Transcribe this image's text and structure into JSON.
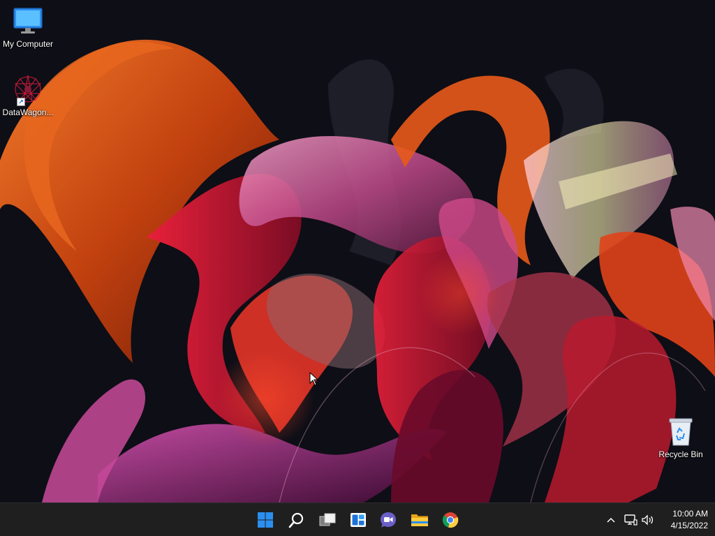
{
  "desktop": {
    "icons": [
      {
        "label": "My Computer",
        "icon": "monitor-icon"
      },
      {
        "label": "DataWagon...",
        "icon": "datawagon-logo-icon",
        "shortcut": true
      },
      {
        "label": "Recycle Bin",
        "icon": "recycle-bin-icon"
      }
    ]
  },
  "taskbar": {
    "pinned": [
      {
        "name": "start",
        "icon": "windows-logo-icon"
      },
      {
        "name": "search",
        "icon": "search-icon"
      },
      {
        "name": "task-view",
        "icon": "task-view-icon"
      },
      {
        "name": "widgets",
        "icon": "widgets-icon"
      },
      {
        "name": "chat",
        "icon": "teams-chat-icon"
      },
      {
        "name": "file-explorer",
        "icon": "folder-icon"
      },
      {
        "name": "chrome",
        "icon": "chrome-icon"
      }
    ],
    "tray": {
      "icons": [
        "chevron-up-icon",
        "network-icon",
        "volume-icon"
      ],
      "time": "10:00 AM",
      "date": "4/15/2022"
    }
  },
  "colors": {
    "taskbar_bg": "#1f1f20",
    "wallpaper_bg": "#0e0e16",
    "accent_blue": "#2b8fef",
    "ribbon_orange": "#d2541a",
    "ribbon_red": "#b81a2e"
  }
}
